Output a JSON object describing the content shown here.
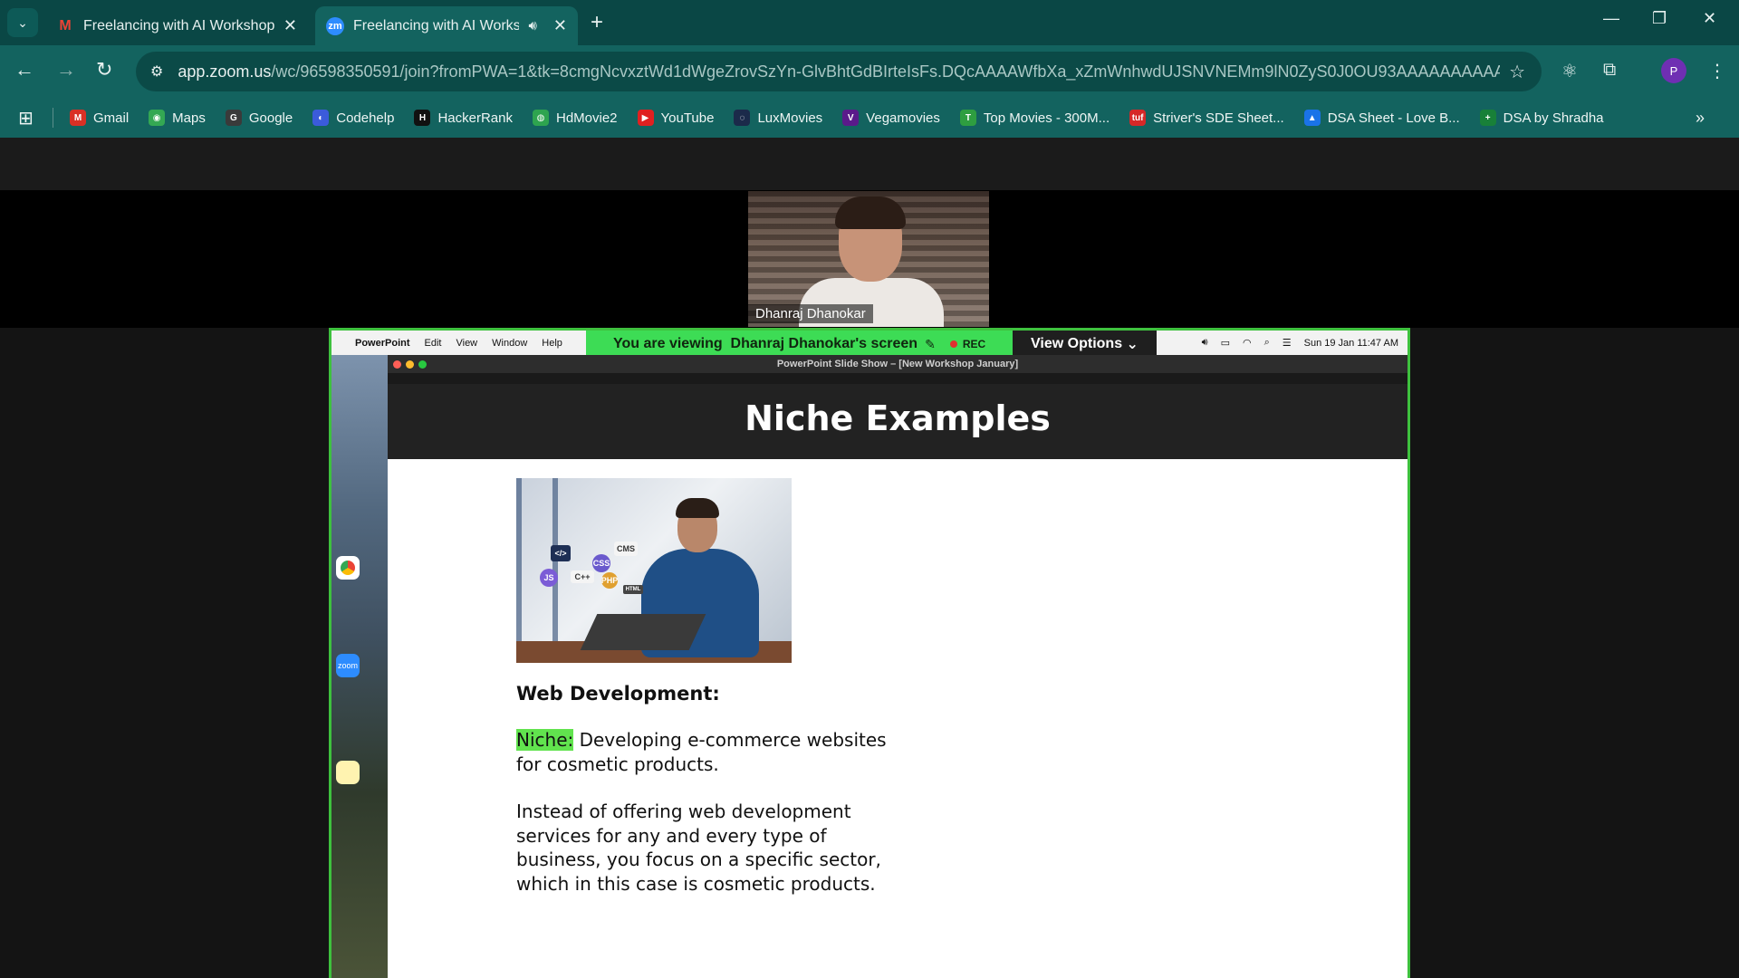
{
  "tabs": [
    {
      "title": "Freelancing with AI Workshop (",
      "favicon": "gmail",
      "active": false
    },
    {
      "title": "Freelancing with AI Worksh",
      "favicon": "zm",
      "active": true
    }
  ],
  "omnibox": {
    "url_host": "app.zoom.us",
    "url_path": "/wc/96598350591/join?fromPWA=1&tk=8cmgNcvxztWd1dWgeZrovSzYn-GlvBhtGdBIrteIsFs.DQcAAAAWfbXa_xZmWnhwdUJSNVNEMm9lN0ZyS0J0OU93AAAAAAAAAAAAAA..."
  },
  "profile_initial": "P",
  "bookmarks": [
    {
      "label": "Gmail",
      "icon": "M",
      "color": "#d93025"
    },
    {
      "label": "Maps",
      "icon": "◉",
      "color": "#34a853"
    },
    {
      "label": "Google",
      "icon": "G",
      "color": "#3a3a3a"
    },
    {
      "label": "Codehelp",
      "icon": "◐",
      "color": "#3b5bdb"
    },
    {
      "label": "HackerRank",
      "icon": "H",
      "color": "#111111"
    },
    {
      "label": "HdMovie2",
      "icon": "◍",
      "color": "#2ea44f"
    },
    {
      "label": "YouTube",
      "icon": "▶",
      "color": "#e02020"
    },
    {
      "label": "LuxMovies",
      "icon": "◌",
      "color": "#1b2a4a"
    },
    {
      "label": "Vegamovies",
      "icon": "V",
      "color": "#5a1a8a"
    },
    {
      "label": "Top Movies - 300M...",
      "icon": "T",
      "color": "#2e9e40"
    },
    {
      "label": "Striver's SDE Sheet...",
      "icon": "tuf",
      "color": "#d62828"
    },
    {
      "label": "DSA Sheet - Love B...",
      "icon": "▲",
      "color": "#1a73e8"
    },
    {
      "label": "DSA by Shradha",
      "icon": "+",
      "color": "#188038"
    }
  ],
  "video": {
    "participant_name": "Dhanraj Dhanokar"
  },
  "share": {
    "viewing_prefix": "You are viewing",
    "viewing_name": "Dhanraj Dhanokar's screen",
    "rec_label": "REC",
    "view_options_label": "View Options"
  },
  "mac_menu": {
    "app": "PowerPoint",
    "items": [
      "Edit",
      "View",
      "Window",
      "Help"
    ],
    "clock": "Sun 19 Jan 11:47 AM"
  },
  "ppt": {
    "window_title": "PowerPoint Slide Show – [New Workshop January]",
    "slide_title": "Niche Examples",
    "subheading": "Web Development:",
    "niche_label": "Niche:",
    "niche_text": " Developing e-commerce websites for cosmetic products.",
    "body": "Instead of offering web development services for any and every type of business, you focus on a specific sector, which in this case is cosmetic products."
  },
  "image_chips": [
    "</>",
    "CMS",
    "CSS",
    "JS",
    "C++",
    "PHP",
    "HTML"
  ],
  "dock_icons": [
    "chrome",
    "zoom",
    "notes"
  ]
}
